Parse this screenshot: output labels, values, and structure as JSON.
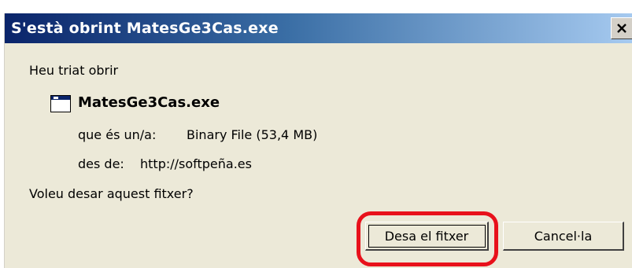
{
  "dialog": {
    "title": "S'està obrint MatesGe3Cas.exe",
    "close_label": "X",
    "intro": "Heu triat obrir",
    "file_name": "MatesGe3Cas.exe",
    "type_label": "que és un/a:",
    "type_value": "Binary File (53,4 MB)",
    "from_label": "des de:",
    "from_value": "http://softpeña.es",
    "question": "Voleu desar aquest fitxer?",
    "save_button": "Desa el fitxer",
    "cancel_button": "Cancel·la"
  },
  "colors": {
    "titlebar_start": "#0a246a",
    "titlebar_end": "#a6caf0",
    "dialog_bg": "#ece9d8",
    "highlight": "#e8111b"
  },
  "icons": {
    "file": "application-window-icon",
    "close": "close-icon"
  }
}
